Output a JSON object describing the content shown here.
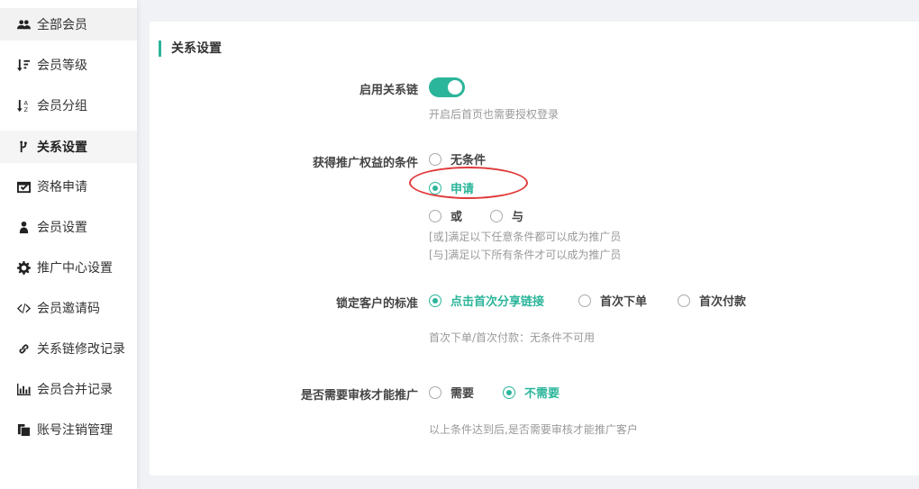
{
  "sidebar": {
    "items": [
      {
        "label": "全部会员",
        "icon": "users-icon"
      },
      {
        "label": "会员等级",
        "icon": "sort-amount-icon"
      },
      {
        "label": "会员分组",
        "icon": "sort-alpha-icon"
      },
      {
        "label": "关系设置",
        "icon": "code-fork-icon"
      },
      {
        "label": "资格申请",
        "icon": "calendar-check-icon"
      },
      {
        "label": "会员设置",
        "icon": "user-icon"
      },
      {
        "label": "推广中心设置",
        "icon": "gear-icon"
      },
      {
        "label": "会员邀请码",
        "icon": "code-icon"
      },
      {
        "label": "关系链修改记录",
        "icon": "link-icon"
      },
      {
        "label": "会员合并记录",
        "icon": "bar-chart-icon"
      },
      {
        "label": "账号注销管理",
        "icon": "copy-icon"
      }
    ],
    "active_index": 3
  },
  "section": {
    "title": "关系设置"
  },
  "accent_color": "#2bb59a",
  "highlight_color": "#e03a3a",
  "form": {
    "relation_chain": {
      "label": "启用关系链",
      "enabled": true,
      "help": "开启后首页也需要授权登录"
    },
    "promotion_condition": {
      "label": "获得推广权益的条件",
      "options": [
        "无条件",
        "申请",
        "或",
        "与"
      ],
      "selected": "申请",
      "help_or": "[或]满足以下任意条件都可以成为推广员",
      "help_and": "[与]满足以下所有条件才可以成为推广员"
    },
    "lock_standard": {
      "label": "锁定客户的标准",
      "options": [
        "点击首次分享链接",
        "首次下单",
        "首次付款"
      ],
      "selected": "点击首次分享链接",
      "help": "首次下单/首次付款：无条件不可用"
    },
    "need_review": {
      "label": "是否需要审核才能推广",
      "options": [
        "需要",
        "不需要"
      ],
      "selected": "不需要",
      "help": "以上条件达到后,是否需要审核才能推广客户"
    }
  }
}
